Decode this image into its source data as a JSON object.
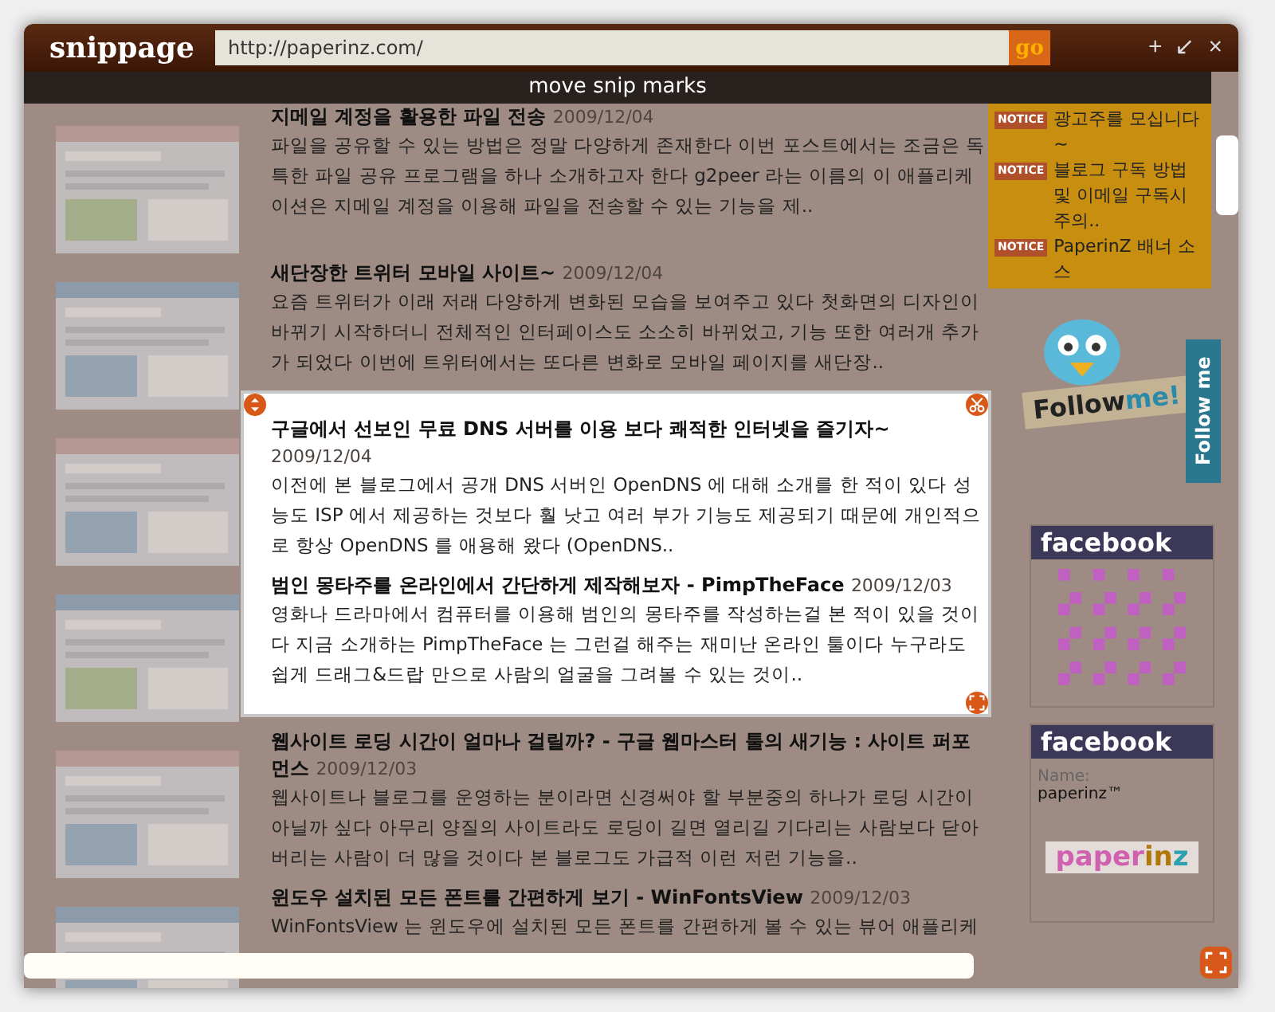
{
  "app": {
    "logo": "snippage",
    "url": "http://paperinz.com/",
    "go_label": "go",
    "controls": [
      "+",
      "↙",
      "×"
    ],
    "hint": "move snip marks"
  },
  "posts": [
    {
      "title": "지메일 계정을 활용한 파일 전송",
      "date": "2009/12/04",
      "body": "파일을 공유할 수 있는 방법은 정말 다양하게 존재한다 이번 포스트에서는 조금은 독특한 파일 공유 프로그램을 하나 소개하고자 한다 g2peer 라는 이름의 이 애플리케이션은 지메일 계정을 이용해 파일을 전송할 수 있는 기능을 제.."
    },
    {
      "title": "새단장한 트위터 모바일 사이트~",
      "date": "2009/12/04",
      "body": "요즘 트위터가 이래 저래 다양하게 변화된 모습을 보여주고 있다 첫화면의 디자인이 바뀌기 시작하더니 전체적인 인터페이스도 소소히 바뀌었고, 기능 또한 여러개 추가가 되었다 이번에 트위터에서는 또다른 변화로 모바일 페이지를 새단장.."
    },
    {
      "title": "구글에서 선보인 무료 DNS 서버를 이용 보다 쾌적한 인터넷을 즐기자~",
      "date": "2009/12/04",
      "body": "이전에 본 블로그에서 공개 DNS 서버인 OpenDNS 에 대해 소개를 한 적이 있다 성능도 ISP 에서 제공하는 것보다 훨 낫고 여러 부가 기능도 제공되기 때문에 개인적으로 항상 OpenDNS 를 애용해 왔다 (OpenDNS.."
    },
    {
      "title": "범인 몽타주를 온라인에서 간단하게 제작해보자 - PimpTheFace",
      "date": "2009/12/03",
      "body": "영화나 드라마에서 컴퓨터를 이용해 범인의 몽타주를 작성하는걸 본 적이 있을 것이다 지금 소개하는 PimpTheFace 는 그런걸 해주는 재미난 온라인 툴이다 누구라도 쉽게 드래그&드랍 만으로 사람의 얼굴을 그려볼 수 있는 것이.."
    },
    {
      "title": "웹사이트 로딩 시간이 얼마나 걸릴까? - 구글 웹마스터 툴의 새기능 : 사이트 퍼포먼스",
      "date": "2009/12/03",
      "body": "웹사이트나 블로그를 운영하는 분이라면 신경써야 할 부분중의 하나가 로딩 시간이 아닐까 싶다 아무리 양질의 사이트라도 로딩이 길면 열리길 기다리는 사람보다 닫아버리는 사람이 더 많을 것이다 본 블로그도 가급적 이런 저런 기능을.."
    },
    {
      "title": "윈도우 설치된 모든 폰트를 간편하게 보기 - WinFontsView",
      "date": "2009/12/03",
      "body": "WinFontsView 는 윈도우에 설치된 모든 폰트를 간편하게 볼 수 있는 뷰어 애플리케"
    }
  ],
  "sidebar": {
    "notices": [
      {
        "badge": "NOTICE",
        "text": "광고주를 모십니다~"
      },
      {
        "badge": "NOTICE",
        "text": "블로그 구독 방법 및 이메일 구독시 주의.."
      },
      {
        "badge": "NOTICE",
        "text": "PaperinZ 배너 소스"
      }
    ],
    "follow_badge": [
      "Follow",
      "me!"
    ],
    "follow_tab": "Follow me",
    "facebook_boxes": [
      {
        "kind": "qr",
        "header": "facebook"
      },
      {
        "kind": "profile",
        "header": "facebook",
        "name_label": "Name:",
        "name": "paperinz™",
        "logo": [
          {
            "text": "paper",
            "color": "#d060b0"
          },
          {
            "text": "in",
            "color": "#b07808"
          },
          {
            "text": "z",
            "color": "#2aa0b0"
          }
        ]
      }
    ]
  }
}
